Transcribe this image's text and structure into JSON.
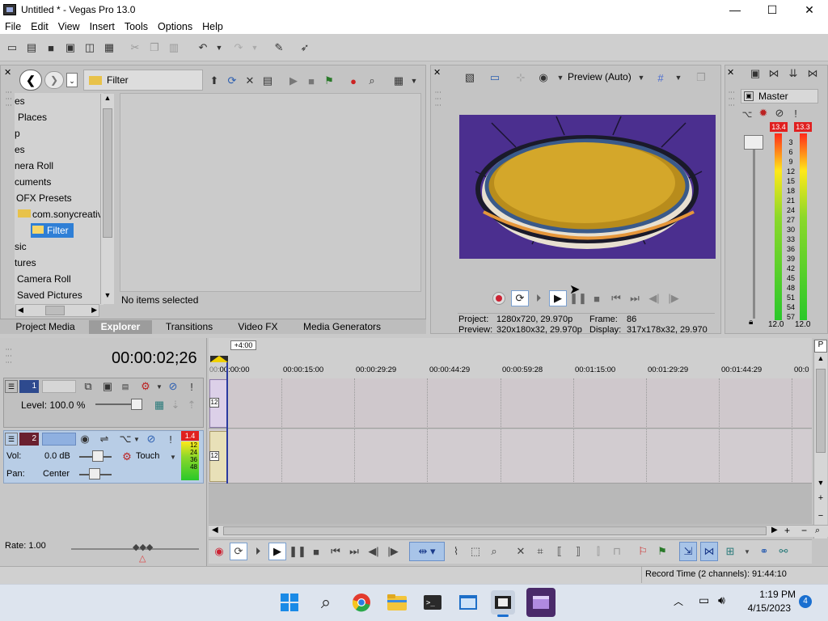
{
  "window": {
    "title": "Untitled * - Vegas Pro 13.0"
  },
  "window_controls": {
    "minimize": "—",
    "maximize": "☐",
    "close": "✕"
  },
  "menu": [
    "File",
    "Edit",
    "View",
    "Insert",
    "Tools",
    "Options",
    "Help"
  ],
  "explorer": {
    "address": "Filter",
    "tree": [
      "es",
      "Places",
      "p",
      "es",
      "nera Roll",
      "cuments",
      "OFX Presets",
      "com.sonycreativ",
      "Filter",
      "sic",
      "tures",
      "Camera Roll",
      "Saved Pictures"
    ],
    "selected": "Filter",
    "status": "No items selected",
    "tabs": [
      "Project Media",
      "Explorer",
      "Transitions",
      "Video FX",
      "Media Generators"
    ],
    "active_tab": "Explorer"
  },
  "preview": {
    "mode": "Preview (Auto)",
    "project_label": "Project:",
    "project_value": "1280x720, 29.970p",
    "preview_label": "Preview:",
    "preview_value": "320x180x32, 29.970p",
    "frame_label": "Frame:",
    "frame_value": "86",
    "display_label": "Display:",
    "display_value": "317x178x32, 29.970"
  },
  "mixer": {
    "master_label": "Master",
    "peak_left": "13.4",
    "peak_right": "13.3",
    "scale": [
      "3",
      "6",
      "9",
      "12",
      "15",
      "18",
      "21",
      "24",
      "27",
      "30",
      "33",
      "36",
      "39",
      "42",
      "45",
      "48",
      "51",
      "54",
      "57"
    ],
    "bottom_left": "12.0",
    "bottom_right": "12.0"
  },
  "timeline": {
    "timecode": "00:00:02;26",
    "offset": "+4:00",
    "ruler": [
      "00:00:00",
      "00:00:15:00",
      "00:00:29:29",
      "00:00:44:29",
      "00:00:59:28",
      "00:01:15:00",
      "00:01:29:29",
      "00:01:44:29",
      "00:0"
    ],
    "video_track": {
      "number": "1",
      "level_label": "Level: 100.0 %"
    },
    "audio_track": {
      "number": "2",
      "peak": "1.4",
      "vol_label": "Vol:",
      "vol_value": "0.0 dB",
      "pan_label": "Pan:",
      "pan_value": "Center",
      "automation": "Touch",
      "meter_scale": [
        "12",
        "24",
        "36",
        "48"
      ]
    },
    "clip_marker": "12",
    "rate": "Rate: 1.00"
  },
  "status": {
    "record_time": "Record Time (2 channels): 91:44:10"
  },
  "taskbar": {
    "time": "1:19 PM",
    "date": "4/15/2023",
    "notifications": "4"
  }
}
